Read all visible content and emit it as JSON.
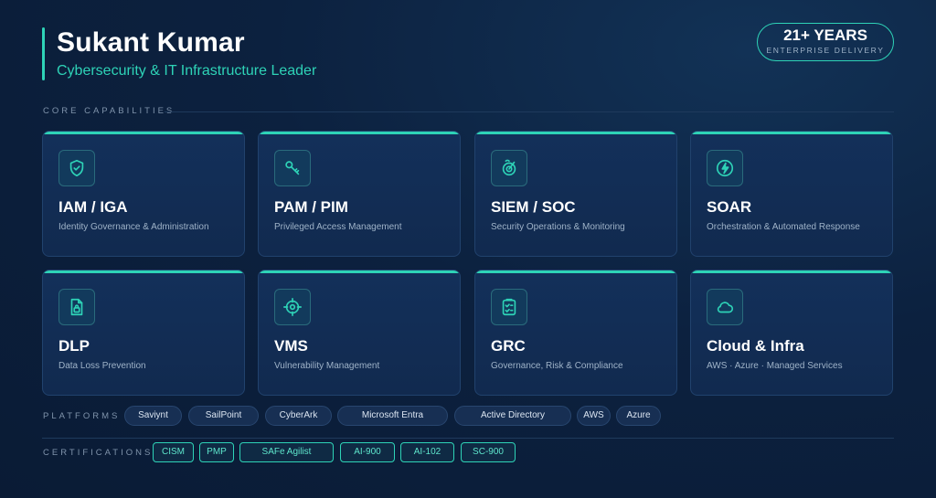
{
  "header": {
    "name": "Sukant Kumar",
    "role": "Cybersecurity & IT Infrastructure Leader"
  },
  "badge": {
    "years": "21+ YEARS",
    "subtitle": "ENTERPRISE DELIVERY"
  },
  "sections": {
    "core": "CORE CAPABILITIES",
    "platforms": "PLATFORMS",
    "certifications": "CERTIFICATIONS"
  },
  "capabilities": [
    {
      "title": "IAM / IGA",
      "desc": "Identity Governance & Administration",
      "icon": "shield-check-icon"
    },
    {
      "title": "PAM / PIM",
      "desc": "Privileged Access Management",
      "icon": "key-icon"
    },
    {
      "title": "SIEM / SOC",
      "desc": "Security Operations & Monitoring",
      "icon": "radar-icon"
    },
    {
      "title": "SOAR",
      "desc": "Orchestration & Automated Response",
      "icon": "bolt-icon"
    },
    {
      "title": "DLP",
      "desc": "Data Loss Prevention",
      "icon": "file-lock-icon"
    },
    {
      "title": "VMS",
      "desc": "Vulnerability Management",
      "icon": "crosshair-icon"
    },
    {
      "title": "GRC",
      "desc": "Governance, Risk & Compliance",
      "icon": "clipboard-check-icon"
    },
    {
      "title": "Cloud & Infra",
      "desc": "AWS · Azure · Managed Services",
      "icon": "cloud-icon"
    }
  ],
  "platforms": [
    "Saviynt",
    "SailPoint",
    "CyberArk",
    "Microsoft Entra",
    "Active Directory",
    "AWS",
    "Azure"
  ],
  "certifications": [
    "CISM",
    "PMP",
    "SAFe Agilist",
    "AI-900",
    "AI-102",
    "SC-900"
  ],
  "colors": {
    "accent": "#2ed3b7",
    "background": "#0c213f",
    "card": "#13305a"
  }
}
